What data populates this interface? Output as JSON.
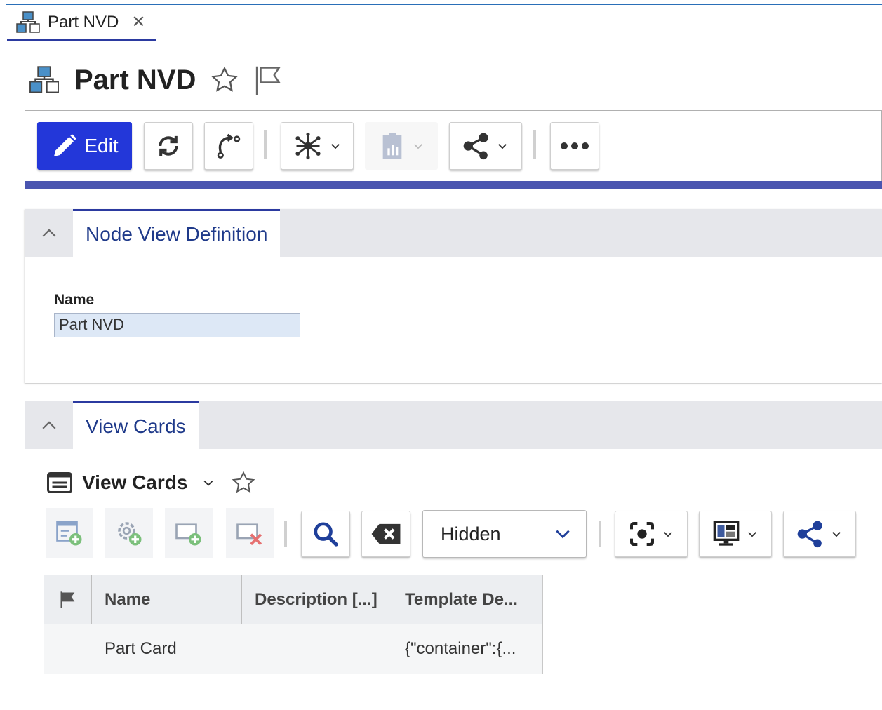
{
  "tab": {
    "label": "Part NVD",
    "close": "✕"
  },
  "header": {
    "title": "Part NVD"
  },
  "toolbar": {
    "edit_label": "Edit"
  },
  "sections": {
    "node_view_definition": {
      "tab_label": "Node View Definition",
      "name_label": "Name",
      "name_value": "Part NVD"
    },
    "view_cards": {
      "tab_label": "View Cards",
      "grid_title": "View Cards",
      "filter_value": "Hidden",
      "columns": [
        "Name",
        "Description [...]",
        "Template De..."
      ],
      "rows": [
        {
          "name": "Part Card",
          "description": "",
          "template": "{\"container\":{..."
        }
      ]
    }
  },
  "colors": {
    "accent": "#2337d9",
    "tab_underline": "#2b3aa0",
    "link_text": "#1f3a8a",
    "toolbar_bar": "#4a55b0"
  },
  "icons": [
    "part-icon",
    "close-icon",
    "star-icon",
    "flag-icon",
    "pencil-icon",
    "refresh-icon",
    "workflow-icon",
    "network-icon",
    "report-icon",
    "share-icon",
    "more-icon",
    "chevron-up-icon",
    "grid-icon",
    "add-row-icon",
    "add-settings-icon",
    "add-item-icon",
    "delete-icon",
    "search-icon",
    "clear-icon",
    "camera-icon",
    "layout-icon",
    "chevron-down-icon"
  ]
}
